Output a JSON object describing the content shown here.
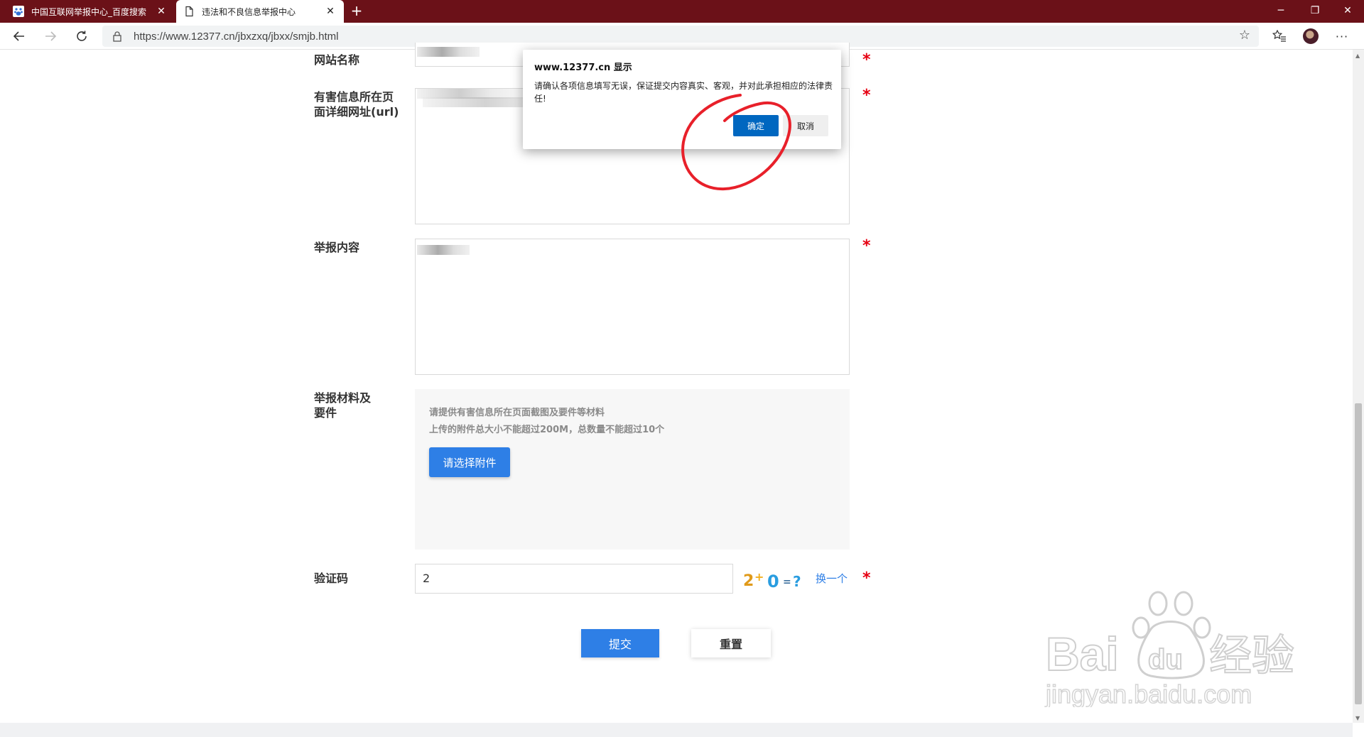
{
  "tabs": [
    {
      "title": "中国互联网举报中心_百度搜索",
      "active": false
    },
    {
      "title": "违法和不良信息举报中心",
      "active": true
    }
  ],
  "address_bar": {
    "url": "https://www.12377.cn/jbxzxq/jbxx/smjb.html"
  },
  "form": {
    "website_name_label": "网站名称",
    "url_label_line1": "有害信息所在页",
    "url_label_line2": "面详细网址(url)",
    "report_content_label": "举报内容",
    "materials_label_line1": "举报材料及",
    "materials_label_line2": "要件",
    "upload_hint_1": "请提供有害信息所在页面截图及要件等材料",
    "upload_hint_2": "上传的附件总大小不能超过200M，总数量不能超过10个",
    "upload_button": "请选择附件",
    "captcha_label": "验证码",
    "captcha_value": "2",
    "captcha_refresh": "换一个",
    "required_mark": "*",
    "submit_button": "提交",
    "reset_button": "重置"
  },
  "dialog": {
    "title": "www.12377.cn 显示",
    "message": "请确认各项信息填写无误，保证提交内容真实、客观，并对此承担相应的法律责任!",
    "ok_button": "确定",
    "cancel_button": "取消"
  },
  "watermark": {
    "line1": "Bai",
    "line1b": "du",
    "cn": "经验",
    "line2": "jingyan.baidu.com"
  },
  "colors": {
    "tabbar": "#6b1118",
    "primary": "#2e7fe6",
    "dialog_ok": "#0067c0",
    "required": "#e60012",
    "annotation": "#e8202a"
  }
}
